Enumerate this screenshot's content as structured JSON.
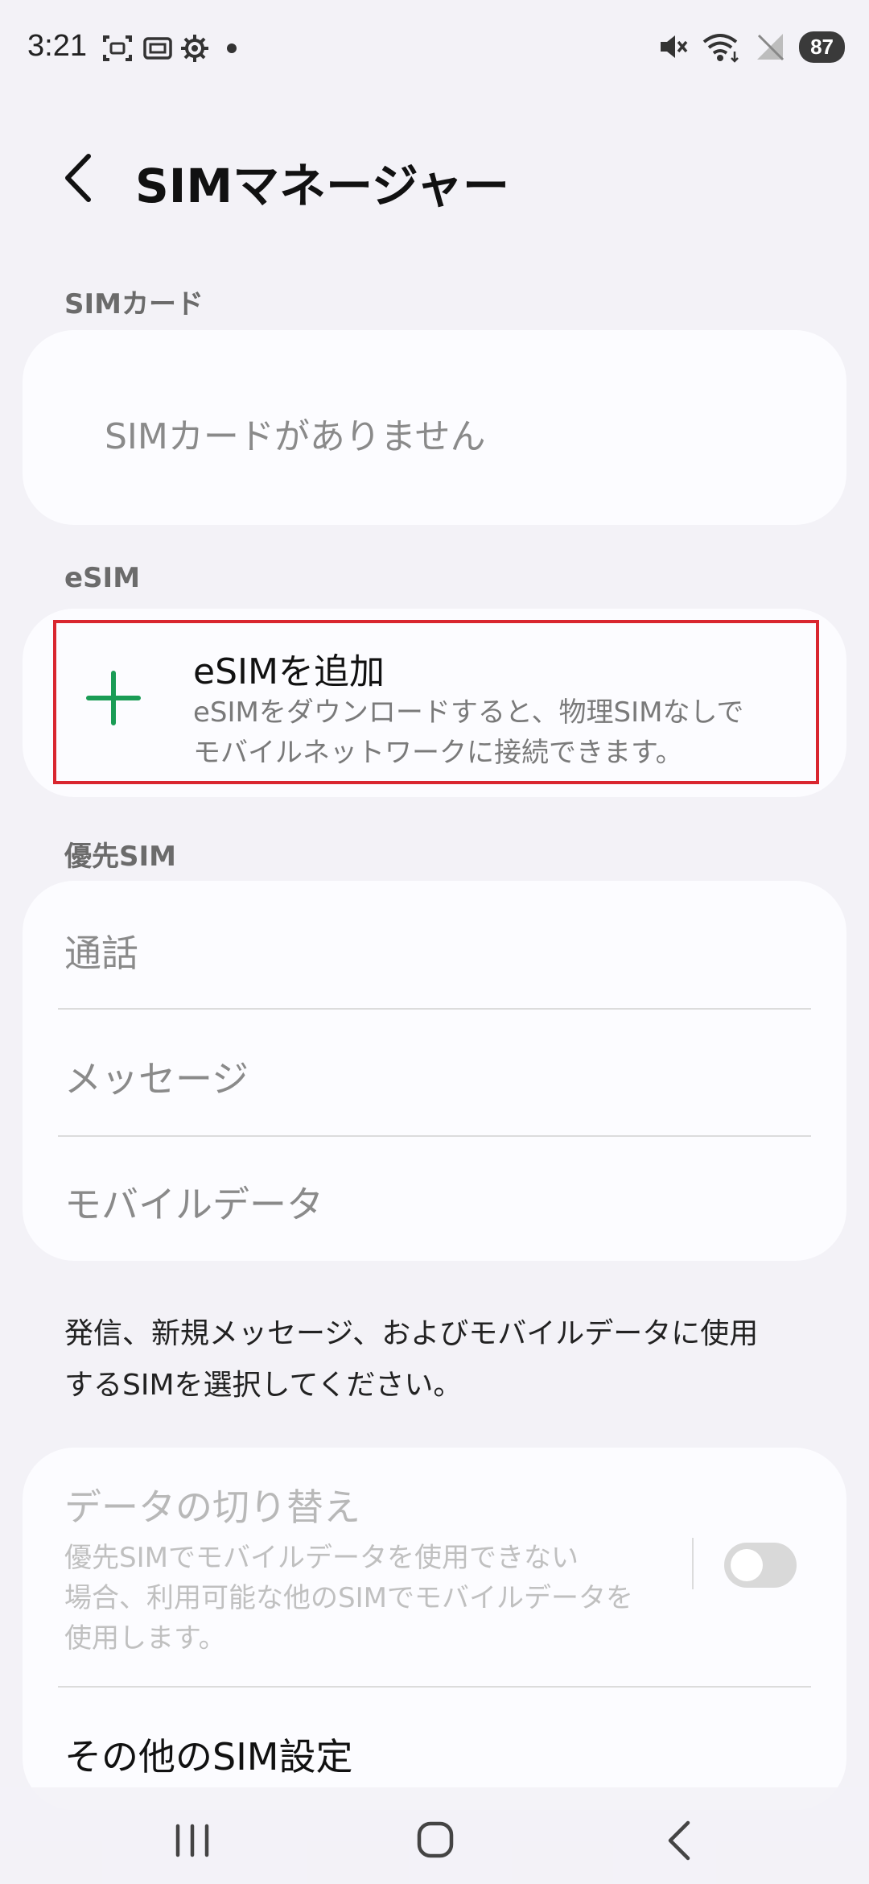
{
  "status_bar": {
    "time": "3:21",
    "battery": "87",
    "left_icons": [
      "screenshot-icon",
      "sim-icon",
      "gear-icon",
      "dot-icon"
    ],
    "right_icons": [
      "mute-icon",
      "wifi-icon",
      "no-signal-icon",
      "battery-icon"
    ]
  },
  "header": {
    "title": "SIMマネージャー"
  },
  "sim_card_section": {
    "label": "SIMカード",
    "empty_text": "SIMカードがありません"
  },
  "esim_section": {
    "label": "eSIM",
    "add_title": "eSIMを追加",
    "add_description_line1": "eSIMをダウンロードすると、物理SIMなしで",
    "add_description_line2": "モバイルネットワークに接続できます。",
    "accent_color": "#1a9c55"
  },
  "preferred_sim_section": {
    "label": "優先SIM",
    "items": [
      "通話",
      "メッセージ",
      "モバイルデータ"
    ]
  },
  "info": {
    "line1": "発信、新規メッセージ、およびモバイルデータに使用",
    "line2": "するSIMを選択してください。"
  },
  "data_switch": {
    "title": "データの切り替え",
    "desc_line1": "優先SIMでモバイルデータを使用できない",
    "desc_line2": "場合、利用可能な他のSIMでモバイルデータを",
    "desc_line3": "使用します。",
    "enabled": false
  },
  "other_settings": {
    "label": "その他のSIM設定"
  },
  "nav_bar": {
    "buttons": [
      "recent-apps-icon",
      "home-icon",
      "back-icon"
    ]
  },
  "colors": {
    "highlight_border": "#d9262f",
    "background": "#f3f2f7",
    "card": "#fcfcff"
  }
}
